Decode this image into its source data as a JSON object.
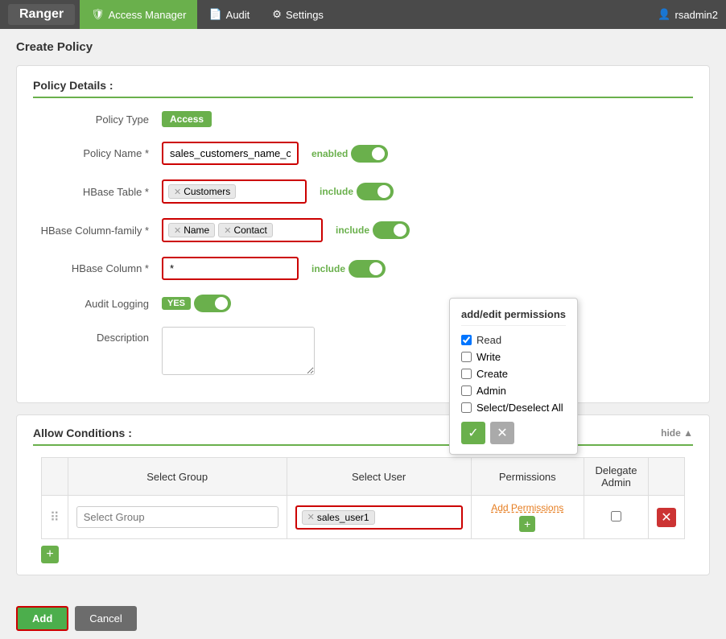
{
  "app": {
    "brand": "Ranger",
    "nav_items": [
      {
        "label": "Access Manager",
        "icon": "shield",
        "active": true
      },
      {
        "label": "Audit",
        "icon": "doc"
      },
      {
        "label": "Settings",
        "icon": "gear"
      }
    ],
    "user": "rsadmin2"
  },
  "page": {
    "title": "Create Policy"
  },
  "policy_details": {
    "section_label": "Policy Details :",
    "policy_type_label": "Policy Type",
    "policy_type_badge": "Access",
    "policy_name_label": "Policy Name *",
    "policy_name_value": "sales_customers_name_contact",
    "policy_name_toggle": "enabled",
    "hbase_table_label": "HBase Table *",
    "hbase_table_tag": "Customers",
    "hbase_table_toggle": "include",
    "hbase_colFamily_label": "HBase Column-family *",
    "hbase_col1_tag": "Name",
    "hbase_col2_tag": "Contact",
    "hbase_colFamily_toggle": "include",
    "hbase_column_label": "HBase Column *",
    "hbase_column_value": "*",
    "hbase_column_toggle": "include",
    "audit_label": "Audit Logging",
    "audit_yes": "YES",
    "description_label": "Description"
  },
  "allow_conditions": {
    "section_label": "Allow Conditions :",
    "hide_label": "hide ▲",
    "col_select_group": "Select Group",
    "col_select_user": "Select User",
    "col_permissions": "Permissions",
    "col_delegate_admin": "Delegate Admin",
    "row": {
      "group_placeholder": "Select Group",
      "user_tag": "sales_user1",
      "add_permissions": "Add Permissions"
    }
  },
  "popup": {
    "title": "add/edit permissions",
    "items": [
      {
        "label": "Read",
        "checked": true
      },
      {
        "label": "Write",
        "checked": false
      },
      {
        "label": "Create",
        "checked": false
      },
      {
        "label": "Admin",
        "checked": false
      },
      {
        "label": "Select/Deselect All",
        "checked": false
      }
    ],
    "confirm_icon": "✓",
    "cancel_icon": "✕"
  },
  "buttons": {
    "add": "Add",
    "cancel": "Cancel"
  }
}
